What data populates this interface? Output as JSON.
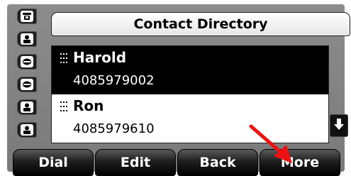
{
  "title": "Contact Directory",
  "contacts": [
    {
      "name": "Harold",
      "number": "4085979002",
      "selected": true
    },
    {
      "name": "Ron",
      "number": "4085979610",
      "selected": false
    }
  ],
  "line_keys": [
    {
      "icon": "phone-handset-icon"
    },
    {
      "icon": "contact-person-icon"
    },
    {
      "icon": "speed-dial-icon"
    },
    {
      "icon": "speed-dial-icon"
    },
    {
      "icon": "contact-person-icon"
    },
    {
      "icon": "contact-person-icon"
    }
  ],
  "softkeys": {
    "dial": "Dial",
    "edit": "Edit",
    "back": "Back",
    "more": "More"
  },
  "scroll_icon": "arrow-down-icon",
  "annotation": {
    "icon": "red-arrow-icon",
    "color": "#ee1111"
  }
}
